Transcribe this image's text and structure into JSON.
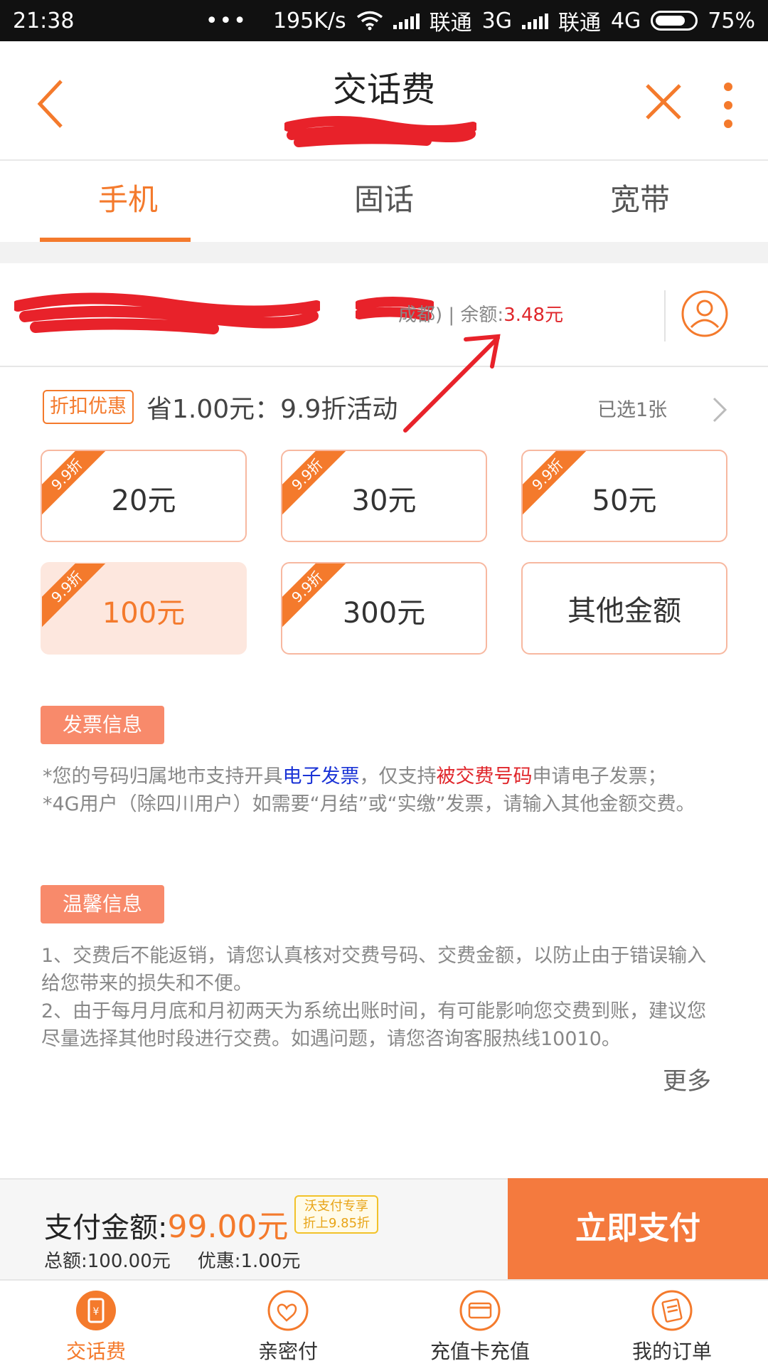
{
  "status_bar": {
    "time": "21:38",
    "dots": "•••",
    "speed": "195K/s",
    "carrier1": "联通",
    "net1": "3G",
    "carrier2": "联通",
    "net2": "4G",
    "battery": "75%",
    "battery_level": 0.75
  },
  "header": {
    "title": "交话费",
    "back_icon": "chevron-left-icon",
    "close_icon": "close-icon",
    "more_icon": "more-vertical-icon"
  },
  "tabs": [
    {
      "label": "手机",
      "active": true
    },
    {
      "label": "固话",
      "active": false
    },
    {
      "label": "宽带",
      "active": false
    }
  ],
  "account": {
    "region_suffix": "成都) | 余额:",
    "balance": "3.48元"
  },
  "discount": {
    "badge": "折扣优惠",
    "text": "省1.00元：9.9折活动",
    "selected": "已选1张"
  },
  "amounts": [
    {
      "label": "20元",
      "ribbon": "9.9折",
      "selected": false
    },
    {
      "label": "30元",
      "ribbon": "9.9折",
      "selected": false
    },
    {
      "label": "50元",
      "ribbon": "9.9折",
      "selected": false
    },
    {
      "label": "100元",
      "ribbon": "9.9折",
      "selected": true
    },
    {
      "label": "300元",
      "ribbon": "9.9折",
      "selected": false
    },
    {
      "label": "其他金额",
      "ribbon": "",
      "selected": false
    }
  ],
  "invoice": {
    "tag": "发票信息",
    "line1_a": "*您的号码归属地市支持开具",
    "line1_b": "电子发票",
    "line1_c": "，仅支持",
    "line1_d": "被交费号码",
    "line1_e": "申请电子发票；",
    "line2": "*4G用户（除四川用户）如需要“月结”或“实缴”发票，请输入其他金额交费。"
  },
  "tips": {
    "tag": "温馨信息",
    "line1": "1、交费后不能返销，请您认真核对交费号码、交费金额，以防止由于错误输入给您带来的损失和不便。",
    "line2": "2、由于每月月底和月初两天为系统出账时间，有可能影响您交费到账，建议您尽量选择其他时段进行交费。如遇问题，请您咨询客服热线10010。",
    "more": "更多"
  },
  "payment": {
    "label": "支付金额:",
    "amount": "99.00元",
    "wo_badge_1": "沃支付专享",
    "wo_badge_2": "折上9.85折",
    "total": "总额:100.00元",
    "discount": "优惠:1.00元",
    "button": "立即支付"
  },
  "bottom_nav": [
    {
      "label": "交话费",
      "icon": "phone-bill-icon",
      "active": true
    },
    {
      "label": "亲密付",
      "icon": "hearts-icon",
      "active": false
    },
    {
      "label": "充值卡充值",
      "icon": "card-icon",
      "active": false
    },
    {
      "label": "我的订单",
      "icon": "order-icon",
      "active": false
    }
  ],
  "colors": {
    "accent": "#f47a2c",
    "pay_button": "#f47a3e",
    "balance_red": "#e0262b",
    "tag_bg": "#f88a6b"
  }
}
